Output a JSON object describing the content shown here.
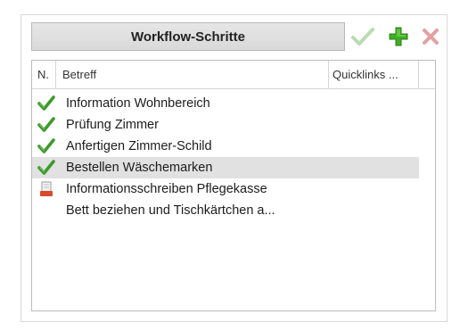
{
  "panel": {
    "title": "Workflow-Schritte"
  },
  "toolbar": {
    "confirm_icon": "check-icon",
    "add_icon": "plus-icon",
    "remove_icon": "close-icon"
  },
  "grid": {
    "columns": [
      "N.",
      "Betreff",
      "Quicklinks ..."
    ],
    "rows": [
      {
        "icon": "check-icon",
        "text": "Information Wohnbereich"
      },
      {
        "icon": "check-icon",
        "text": "Prüfung Zimmer"
      },
      {
        "icon": "check-icon",
        "text": "Anfertigen Zimmer-Schild"
      },
      {
        "icon": "check-icon",
        "text": "Bestellen Wäschemarken",
        "selected": true
      },
      {
        "icon": "document-icon",
        "text": "Informationsschreiben Pflegekasse"
      },
      {
        "icon": "",
        "text": "Bett beziehen und Tischkärtchen a..."
      }
    ]
  },
  "colors": {
    "check_green": "#3c9a2a",
    "plus_green": "#3fae24",
    "close_red": "#e3a0a0",
    "selected_row": "#e1e1e1"
  }
}
